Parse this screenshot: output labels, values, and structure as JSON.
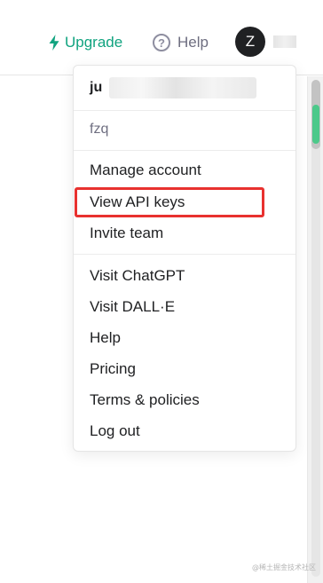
{
  "header": {
    "upgrade_label": "Upgrade",
    "help_label": "Help",
    "avatar_initial": "Z",
    "accent_color": "#10a37f"
  },
  "menu": {
    "user_name_prefix": "ju",
    "org_name": "fzq",
    "items_group1": [
      {
        "label": "Manage account"
      },
      {
        "label": "View API keys"
      },
      {
        "label": "Invite team"
      }
    ],
    "items_group2": [
      {
        "label": "Visit ChatGPT"
      },
      {
        "label": "Visit DALL·E"
      },
      {
        "label": "Help"
      },
      {
        "label": "Pricing"
      },
      {
        "label": "Terms & policies"
      },
      {
        "label": "Log out"
      }
    ],
    "highlight_color": "#e8312f"
  },
  "icons": {
    "upgrade": "lightning-bolt-icon",
    "help": "question-circle-icon"
  },
  "watermark": "@稀土掘金技术社区"
}
